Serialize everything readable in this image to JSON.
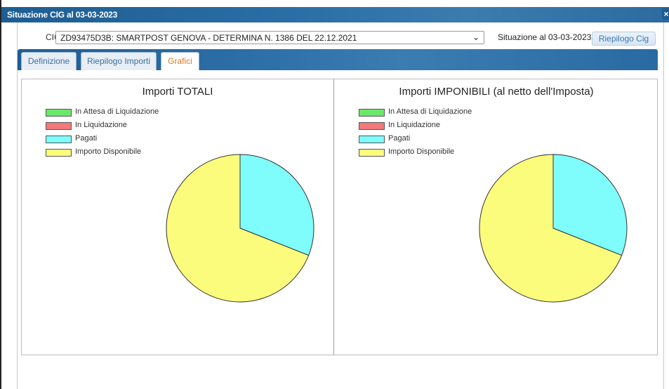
{
  "window": {
    "title": "Situazione CIG al 03-03-2023",
    "close_symbol": "×"
  },
  "cig": {
    "label": "CIG",
    "selected": "ZD93475D3B: SMARTPOST GENOVA - DETERMINA N. 1386 DEL 22.12.2021",
    "situazione": "Situazione al 03-03-2023",
    "riepilogo_button": "Riepilogo Cig"
  },
  "tabs": [
    {
      "label": "Definizione",
      "active": false
    },
    {
      "label": "Riepilogo Importi",
      "active": false
    },
    {
      "label": "Grafici",
      "active": true
    }
  ],
  "colors": {
    "in_attesa": "#6be86b",
    "in_liquidazione": "#f27a7a",
    "pagati": "#7ffcfc",
    "importo_disponibile": "#fcfc7c",
    "accent_tab": "#e07a1e"
  },
  "legend": [
    {
      "label": "In Attesa di Liquidazione",
      "color": "#6be86b"
    },
    {
      "label": "In Liquidazione",
      "color": "#f27a7a"
    },
    {
      "label": "Pagati",
      "color": "#7ffcfc"
    },
    {
      "label": "Importo Disponibile",
      "color": "#fcfc7c"
    }
  ],
  "chart_data": [
    {
      "type": "pie",
      "title": "Importi TOTALI",
      "categories": [
        "In Attesa di Liquidazione",
        "In Liquidazione",
        "Pagati",
        "Importo Disponibile"
      ],
      "values": [
        0,
        0,
        31,
        69
      ],
      "legend_position": "top-left"
    },
    {
      "type": "pie",
      "title": "Importi IMPONIBILI (al netto dell'Imposta)",
      "categories": [
        "In Attesa di Liquidazione",
        "In Liquidazione",
        "Pagati",
        "Importo Disponibile"
      ],
      "values": [
        0,
        0,
        31,
        69
      ],
      "legend_position": "top-left"
    }
  ]
}
